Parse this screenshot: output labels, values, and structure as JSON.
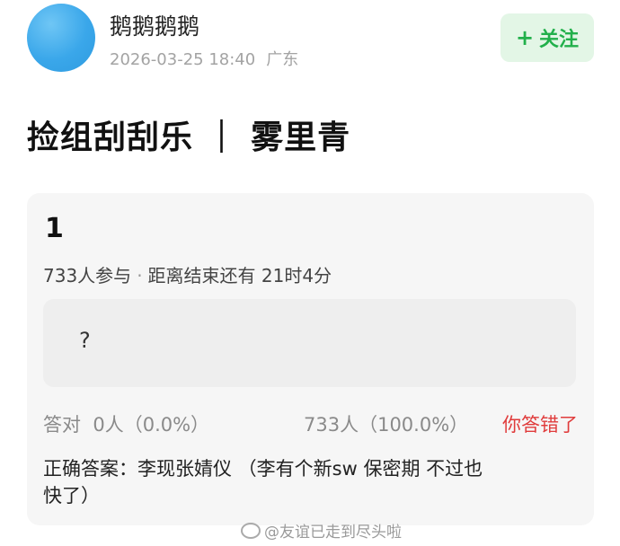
{
  "author": {
    "name": "鹅鹅鹅鹅",
    "timestamp": "2026-03-25 18:40",
    "location": "广东",
    "follow_label": "关注",
    "follow_icon": "plus-icon"
  },
  "post": {
    "title": "捡组刮刮乐 ｜ 雾里青"
  },
  "quiz": {
    "number": "1",
    "participants": "733人参与",
    "separator": "·",
    "time_left": "距离结束还有 21时4分",
    "answer_placeholder": "?",
    "correct_stat": "答对  0人（0.0%）",
    "wrong_stat": "733人（100.0%）",
    "verdict": "你答错了",
    "correct_answer_line1": "正确答案：李现张婧仪 （李有个新sw 保密期 不过也",
    "correct_answer_line2": "快了）"
  },
  "watermark": {
    "text": "@友谊已走到尽头啦",
    "icon": "weibo-icon"
  },
  "colors": {
    "follow_bg": "#e3f6e6",
    "follow_text": "#22b04b",
    "verdict": "#e03b3b",
    "card_bg": "#f6f6f6",
    "avatar": "#3aa7ea"
  }
}
